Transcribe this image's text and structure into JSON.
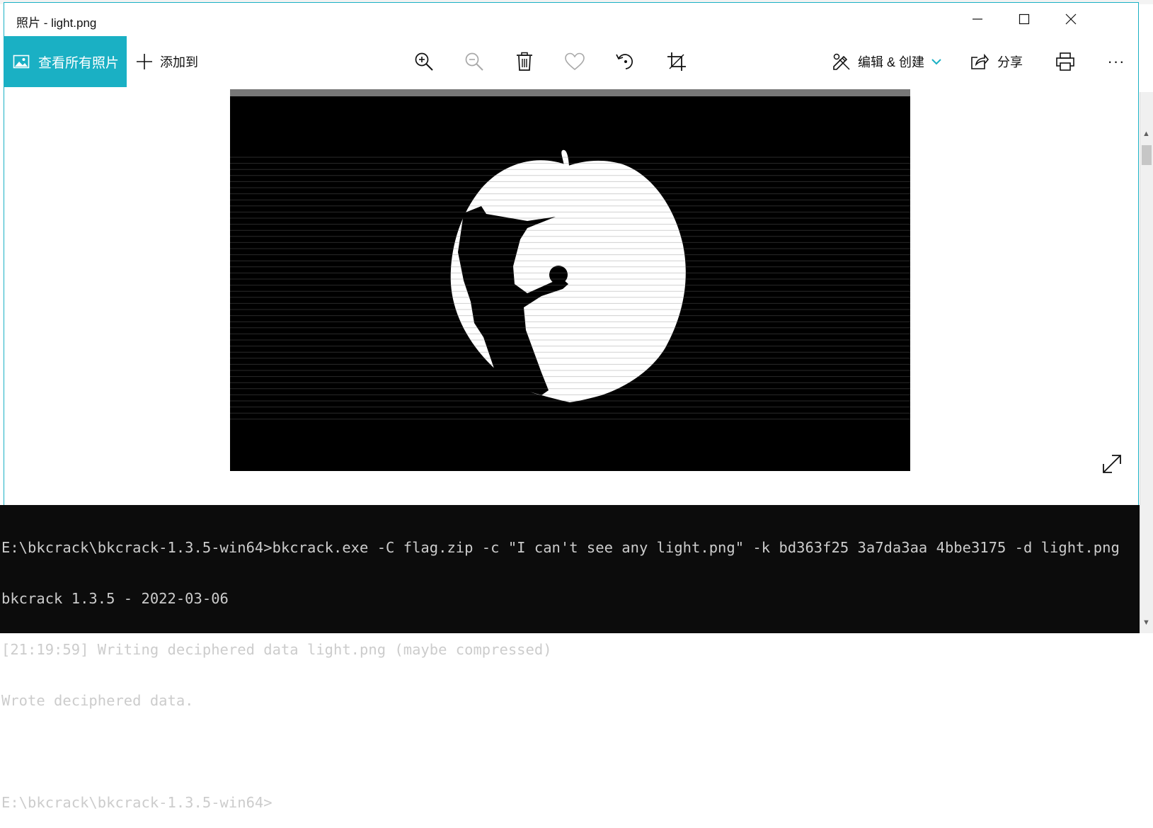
{
  "window": {
    "title": "照片 - light.png",
    "controls": [
      "minimize-icon",
      "maximize-icon",
      "close-icon"
    ]
  },
  "toolbar": {
    "view_all_label": "查看所有照片",
    "add_to_label": "添加到",
    "icons": [
      "zoom-in-icon",
      "zoom-out-icon",
      "delete-icon",
      "favorite-heart-icon",
      "rotate-icon",
      "crop-icon"
    ],
    "edit_create_label": "编辑 & 创建",
    "share_label": "分享",
    "print_icon": "print-icon",
    "more_label": "···"
  },
  "colors": {
    "accent": "#1ab0c4",
    "console_bg": "#0c0c0c",
    "console_fg": "#cccccc"
  },
  "image": {
    "filename": "light.png",
    "description_icon": "apple-silhouette"
  },
  "console": {
    "lines": [
      "E:\\bkcrack\\bkcrack-1.3.5-win64>bkcrack.exe -C flag.zip -c \"I can't see any light.png\" -k bd363f25 3a7da3aa 4bbe3175 -d light.png",
      "bkcrack 1.3.5 - 2022-03-06",
      "[21:19:59] Writing deciphered data light.png (maybe compressed)",
      "Wrote deciphered data.",
      "",
      "E:\\bkcrack\\bkcrack-1.3.5-win64>"
    ]
  }
}
